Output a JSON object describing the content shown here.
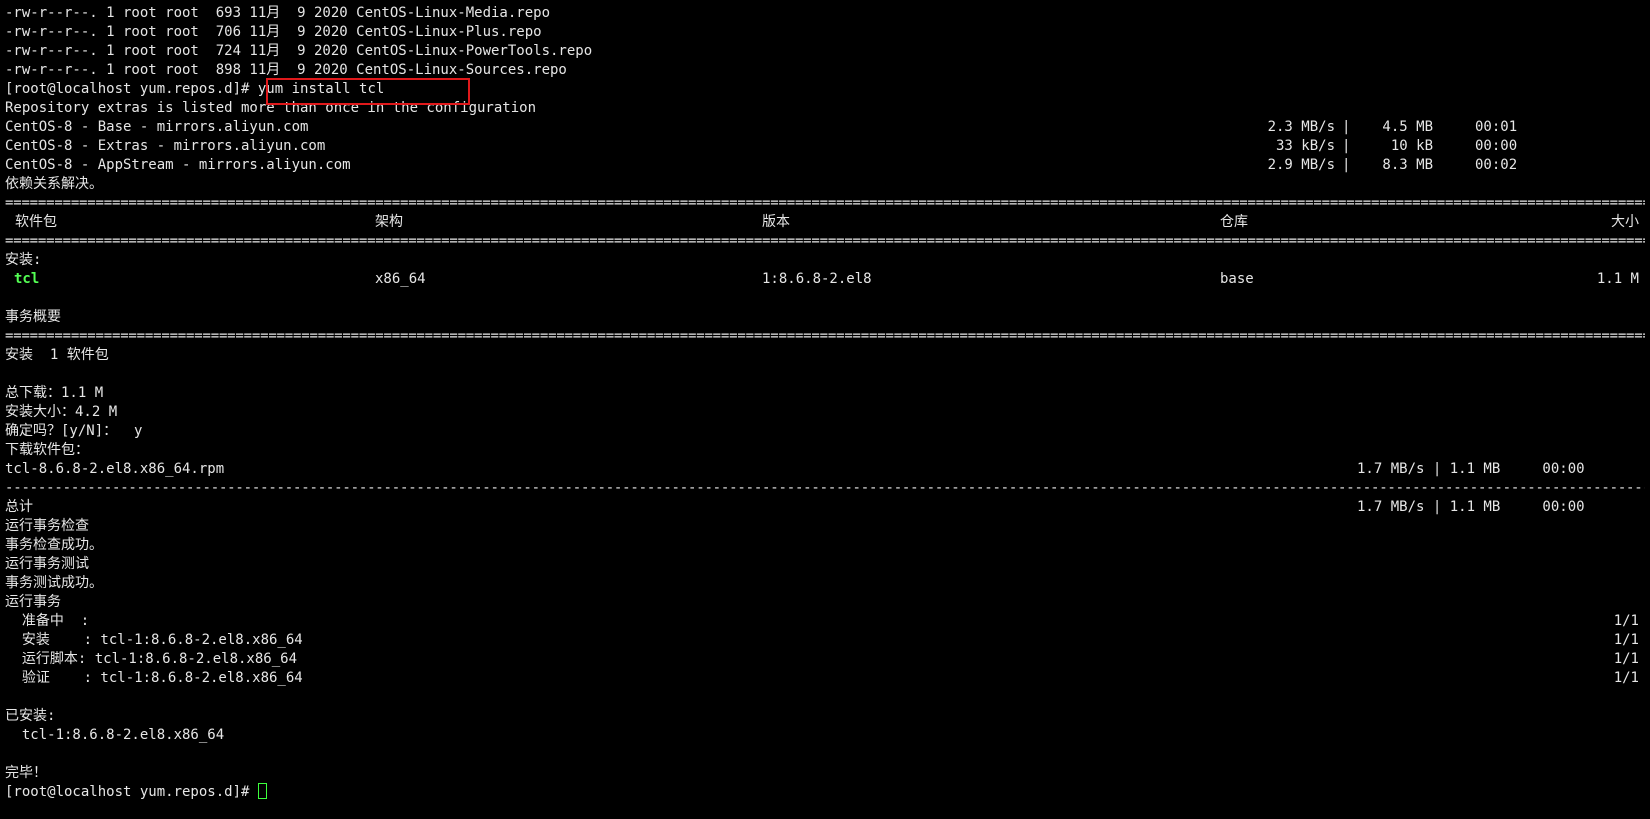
{
  "file_listing": [
    "-rw-r--r--. 1 root root  693 11月  9 2020 CentOS-Linux-Media.repo",
    "-rw-r--r--. 1 root root  706 11月  9 2020 CentOS-Linux-Plus.repo",
    "-rw-r--r--. 1 root root  724 11月  9 2020 CentOS-Linux-PowerTools.repo",
    "-rw-r--r--. 1 root root  898 11月  9 2020 CentOS-Linux-Sources.repo"
  ],
  "prompt": "[root@localhost yum.repos.d]#",
  "command": " yum install tcl",
  "warning": "Repository extras is listed more than once in the configuration",
  "repos": [
    {
      "name": "CentOS-8 - Base - mirrors.aliyun.com",
      "speed": "2.3 MB/s",
      "size": "4.5 MB",
      "time": "00:01"
    },
    {
      "name": "CentOS-8 - Extras - mirrors.aliyun.com",
      "speed": " 33 kB/s",
      "size": " 10 kB",
      "time": "00:00"
    },
    {
      "name": "CentOS-8 - AppStream - mirrors.aliyun.com",
      "speed": "2.9 MB/s",
      "size": "8.3 MB",
      "time": "00:02"
    }
  ],
  "deps_resolved": "依赖关系解决。",
  "separator_double": "====================================================================================================================================================================================================================",
  "separator_single": "--------------------------------------------------------------------------------------------------------------------------------------------------------------------------------------------------------------------",
  "table_headers": {
    "package": "软件包",
    "arch": "架构",
    "version": "版本",
    "repo": "仓库",
    "size": "大小"
  },
  "install_label": "安装:",
  "package_row": {
    "name": "tcl",
    "arch": "x86_64",
    "version": "1:8.6.8-2.el8",
    "repo": "base",
    "size": "1.1 M"
  },
  "transaction_summary": "事务概要",
  "install_count": "安装  1 软件包",
  "total_download": "总下载：1.1 M",
  "install_size": "安装大小：4.2 M",
  "confirm_prompt": "确定吗？[y/N]：  y",
  "downloading": "下载软件包：",
  "rpm_download": {
    "name": "tcl-8.6.8-2.el8.x86_64.rpm",
    "stats": "1.7 MB/s | 1.1 MB     00:00"
  },
  "total_row": {
    "label": "总计",
    "stats": "1.7 MB/s | 1.1 MB     00:00"
  },
  "transaction_steps": [
    "运行事务检查",
    "事务检查成功。",
    "运行事务测试",
    "事务测试成功。",
    "运行事务"
  ],
  "transaction_actions": [
    {
      "label": "  准备中  :",
      "progress": "1/1"
    },
    {
      "label": "  安装    : tcl-1:8.6.8-2.el8.x86_64",
      "progress": "1/1"
    },
    {
      "label": "  运行脚本: tcl-1:8.6.8-2.el8.x86_64",
      "progress": "1/1"
    },
    {
      "label": "  验证    : tcl-1:8.6.8-2.el8.x86_64",
      "progress": "1/1"
    }
  ],
  "installed_label": "已安装:",
  "installed_package": "  tcl-1:8.6.8-2.el8.x86_64",
  "done": "完毕！",
  "final_prompt": "[root@localhost yum.repos.d]#",
  "colors": {
    "background": "#000000",
    "text": "#e6e6e6",
    "package_highlight": "#54ff54",
    "annotation_box": "#e0191b",
    "cursor": "#3cff3c"
  }
}
